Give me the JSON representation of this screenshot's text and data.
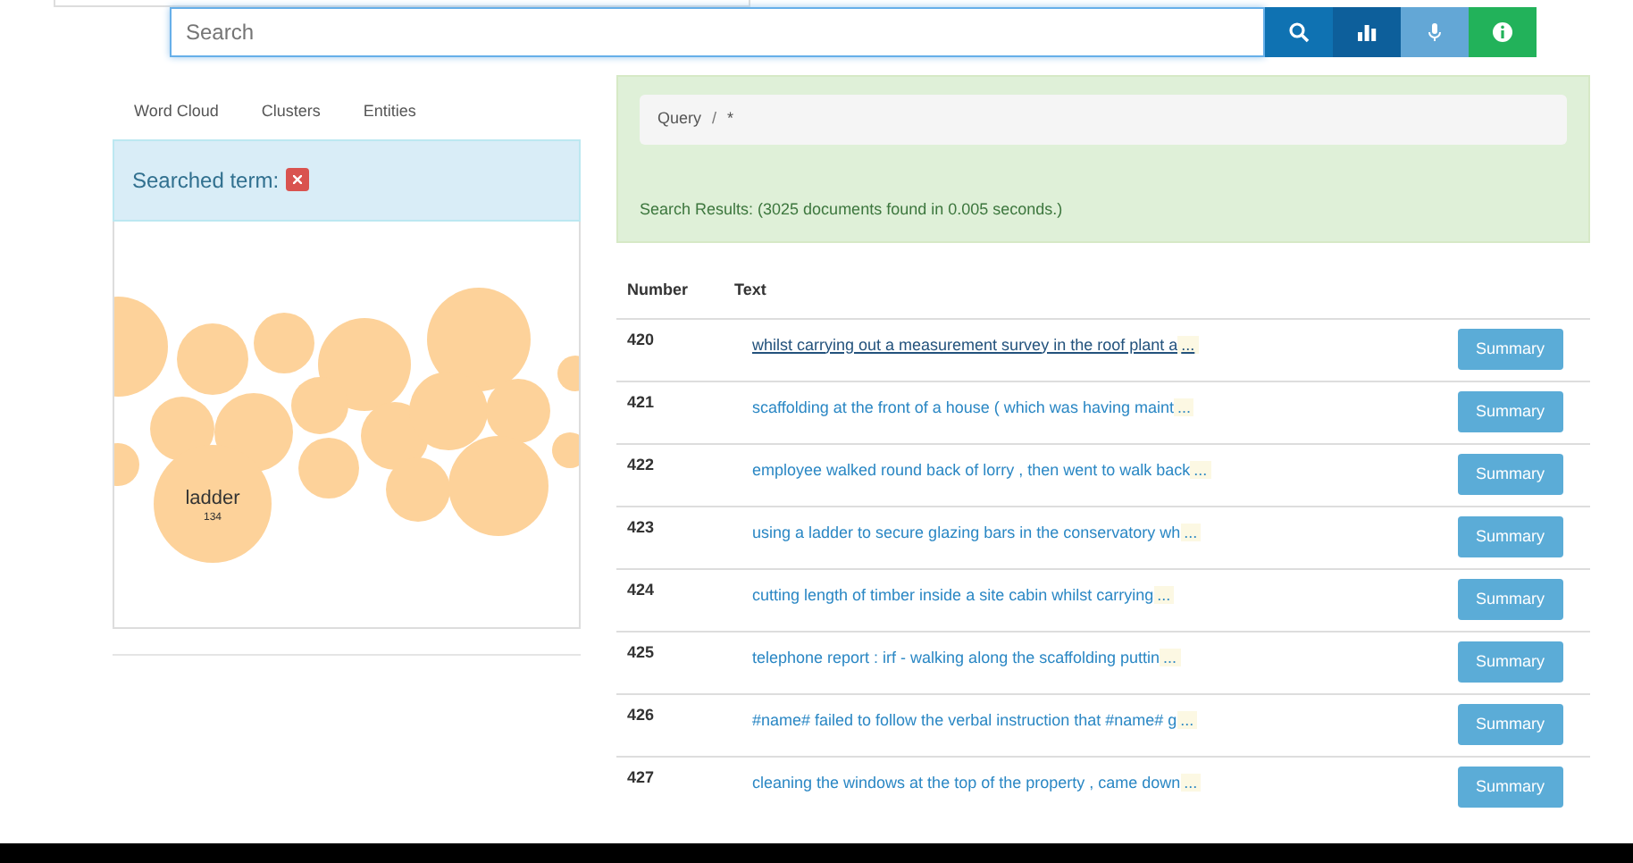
{
  "search": {
    "placeholder": "Search",
    "buttons": [
      {
        "kind": "search",
        "color": "#0f72b2"
      },
      {
        "kind": "chart",
        "color": "#0d5f9b"
      },
      {
        "kind": "mic",
        "color": "#63a7d6"
      },
      {
        "kind": "info",
        "color": "#22b25a"
      }
    ]
  },
  "left_tabs": [
    "Word Cloud",
    "Clusters",
    "Entities"
  ],
  "searched_term": {
    "label": "Searched term:"
  },
  "word_cloud": [
    {
      "word": "ladder",
      "count": "134"
    }
  ],
  "query": {
    "crumbs": [
      "Query",
      "*"
    ],
    "separator": "/",
    "results": "Search Results: (3025 documents found in 0.005 seconds.)"
  },
  "table": {
    "columns": [
      "Number",
      "Text"
    ],
    "rows": [
      {
        "number": "420",
        "text": "whilst carrying out a measurement survey in the roof plant a",
        "more": "...",
        "hovered": true,
        "button": "Summary"
      },
      {
        "number": "421",
        "text": "scaffolding at the front of a house ( which was having maint",
        "more": "...",
        "hovered": false,
        "button": "Summary"
      },
      {
        "number": "422",
        "text": "employee walked round back of lorry , then went to walk back",
        "more": "...",
        "hovered": false,
        "button": "Summary"
      },
      {
        "number": "423",
        "text": "using a ladder to secure glazing bars in the conservatory wh",
        "more": "...",
        "hovered": false,
        "button": "Summary"
      },
      {
        "number": "424",
        "text": "cutting length of timber inside a site cabin whilst carrying",
        "more": "...",
        "hovered": false,
        "button": "Summary"
      },
      {
        "number": "425",
        "text": "telephone report : irf - walking along the scaffolding puttin",
        "more": "...",
        "hovered": false,
        "button": "Summary"
      },
      {
        "number": "426",
        "text": "#name# failed to follow the verbal instruction that #name# g",
        "more": "...",
        "hovered": false,
        "button": "Summary"
      },
      {
        "number": "427",
        "text": "cleaning the windows at the top of the property , came down",
        "more": "...",
        "hovered": false,
        "button": "Summary"
      }
    ]
  }
}
